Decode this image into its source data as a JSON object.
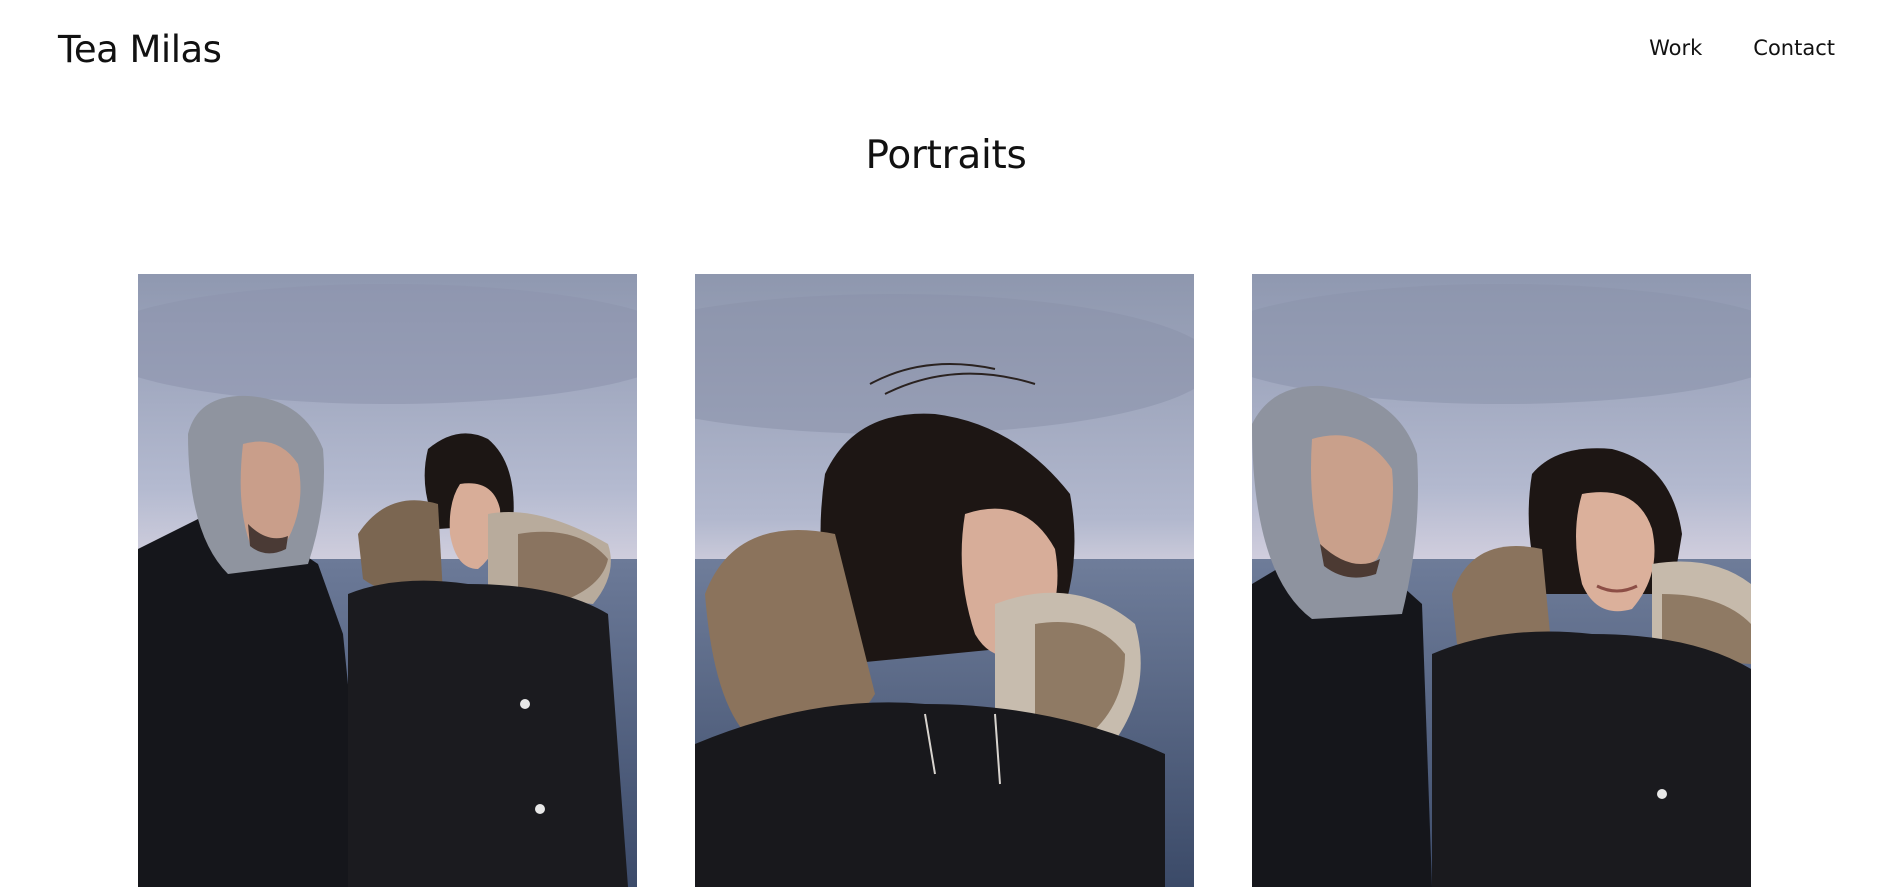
{
  "header": {
    "brand": "Tea Milas",
    "nav": [
      {
        "label": "Work"
      },
      {
        "label": "Contact"
      }
    ]
  },
  "main": {
    "title": "Portraits",
    "photos": [
      {
        "subject": "portrait-couple-looking-away"
      },
      {
        "subject": "portrait-woman-fur-hood-profile"
      },
      {
        "subject": "portrait-couple-smiling"
      }
    ]
  },
  "colors": {
    "text": "#111111",
    "background": "#ffffff",
    "sky": "#9aa3bb",
    "sea": "#4e5f80",
    "coat": "#17181c"
  }
}
